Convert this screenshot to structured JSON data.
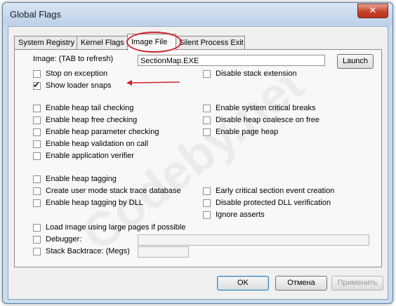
{
  "window": {
    "title": "Global Flags",
    "close_glyph": "✕"
  },
  "tabs": [
    {
      "label": "System Registry",
      "active": false
    },
    {
      "label": "Kernel Flags",
      "active": false
    },
    {
      "label": "Image File",
      "active": true
    },
    {
      "label": "Silent Process Exit",
      "active": false
    }
  ],
  "image_row": {
    "label": "Image: (TAB to refresh)",
    "value": "SectionMap.EXE",
    "launch_label": "Launch"
  },
  "checkboxes": {
    "stop_on_exception": {
      "label": "Stop on exception",
      "checked": false
    },
    "show_loader_snaps": {
      "label": "Show loader snaps",
      "checked": true
    },
    "disable_stack_extension": {
      "label": "Disable stack extension",
      "checked": false
    },
    "heap_tail_checking": {
      "label": "Enable heap tail checking",
      "checked": false
    },
    "heap_free_checking": {
      "label": "Enable heap free checking",
      "checked": false
    },
    "heap_parameter_checking": {
      "label": "Enable heap parameter checking",
      "checked": false
    },
    "heap_validation_on_call": {
      "label": "Enable heap validation on call",
      "checked": false
    },
    "application_verifier": {
      "label": "Enable application verifier",
      "checked": false
    },
    "system_critical_breaks": {
      "label": "Enable system critical breaks",
      "checked": false
    },
    "disable_heap_coalesce": {
      "label": "Disable heap coalesce on free",
      "checked": false
    },
    "page_heap": {
      "label": "Enable page heap",
      "checked": false
    },
    "heap_tagging": {
      "label": "Enable heap tagging",
      "checked": false
    },
    "user_mode_stack_trace": {
      "label": "Create user mode stack trace database",
      "checked": false
    },
    "heap_tagging_by_dll": {
      "label": "Enable heap tagging by DLL",
      "checked": false
    },
    "early_critical_section": {
      "label": "Early critical section event creation",
      "checked": false
    },
    "disable_protected_dll": {
      "label": "Disable protected DLL verification",
      "checked": false
    },
    "ignore_asserts": {
      "label": "Ignore asserts",
      "checked": false
    },
    "large_pages": {
      "label": "Load image using large pages if possible",
      "checked": false
    },
    "debugger": {
      "label": "Debugger:",
      "checked": false,
      "value": ""
    },
    "stack_backtrace": {
      "label": "Stack Backtrace: (Megs)",
      "checked": false,
      "value": ""
    }
  },
  "buttons": {
    "ok": "OK",
    "cancel": "Отмена",
    "apply": "Применить"
  },
  "watermark": "Codeby.net",
  "colors": {
    "window_frame": "#c9dbee",
    "annotation_red": "#d0222e",
    "close_red": "#c7442c"
  }
}
